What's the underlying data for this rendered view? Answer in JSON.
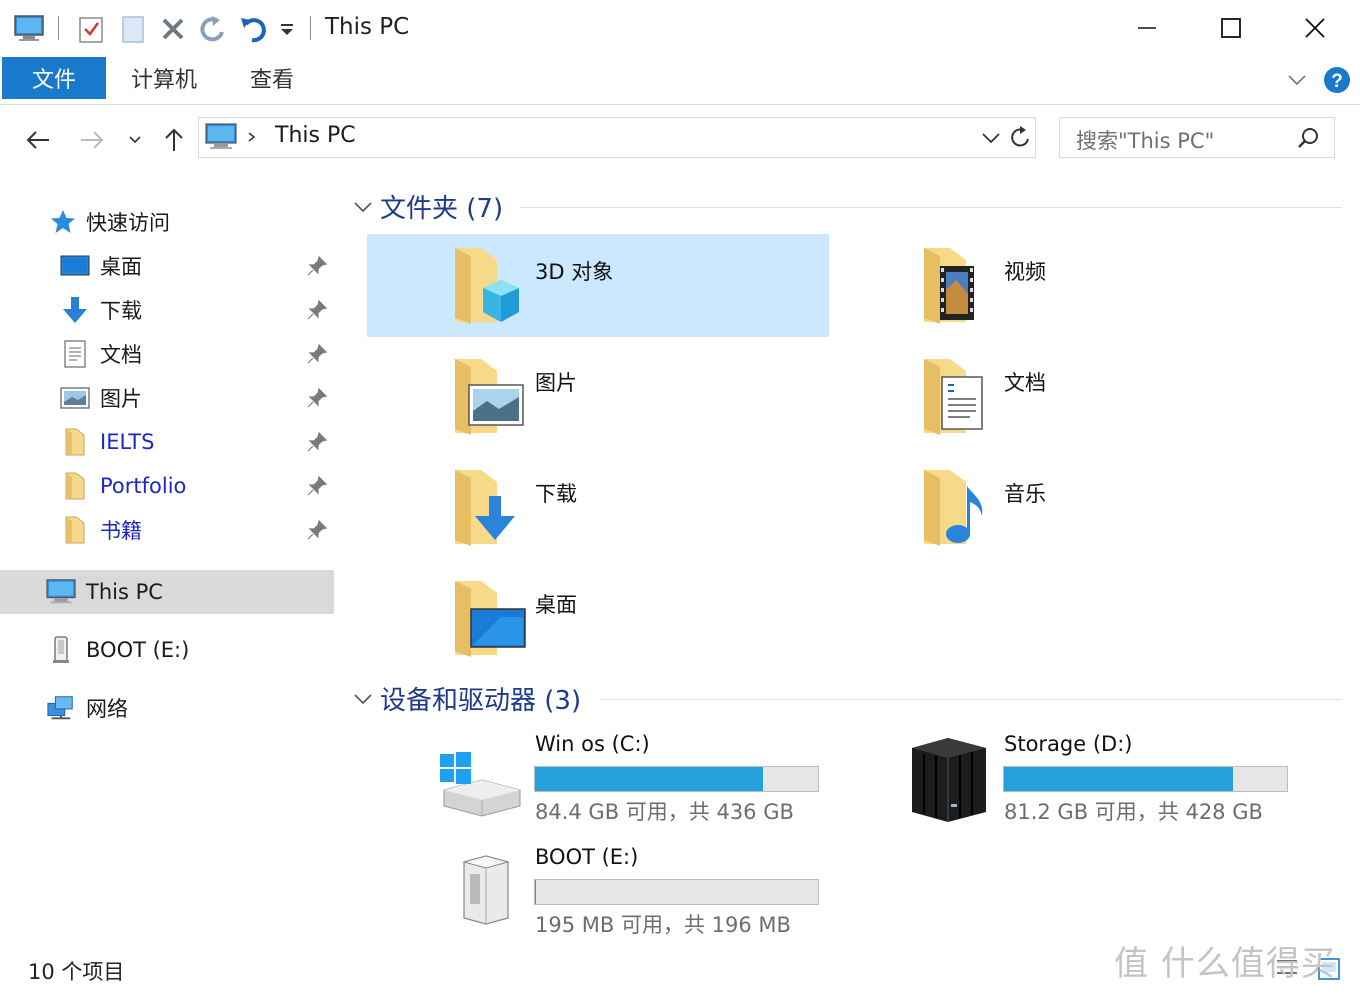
{
  "window": {
    "title": "This PC",
    "quick_access_toolbar": [
      "computer-icon",
      "properties-icon",
      "new-folder-icon",
      "delete-icon",
      "redo-icon",
      "undo-icon",
      "customize-dropdown-icon"
    ]
  },
  "ribbon": {
    "tabs": [
      {
        "label": "文件",
        "active": true
      },
      {
        "label": "计算机",
        "active": false
      },
      {
        "label": "查看",
        "active": false
      }
    ]
  },
  "address": {
    "path": "This PC",
    "search_placeholder": "搜索\"This PC\""
  },
  "nav": {
    "quick_access_label": "快速访问",
    "items": [
      {
        "label": "桌面",
        "icon": "desktop-icon",
        "pinned": true,
        "link": false
      },
      {
        "label": "下载",
        "icon": "download-icon",
        "pinned": true,
        "link": false
      },
      {
        "label": "文档",
        "icon": "document-icon",
        "pinned": true,
        "link": false
      },
      {
        "label": "图片",
        "icon": "picture-icon",
        "pinned": true,
        "link": false
      },
      {
        "label": "IELTS",
        "icon": "folder-icon",
        "pinned": true,
        "link": true
      },
      {
        "label": "Portfolio",
        "icon": "folder-icon",
        "pinned": true,
        "link": true
      },
      {
        "label": "书籍",
        "icon": "folder-icon",
        "pinned": true,
        "link": true
      }
    ],
    "this_pc_label": "This PC",
    "boot_label": "BOOT (E:)",
    "network_label": "网络"
  },
  "folders": {
    "heading": "文件夹 (7)",
    "items": [
      {
        "label": "3D 对象",
        "icon": "3d-objects-folder-icon",
        "selected": true
      },
      {
        "label": "视频",
        "icon": "videos-folder-icon",
        "selected": false
      },
      {
        "label": "图片",
        "icon": "pictures-folder-icon",
        "selected": false
      },
      {
        "label": "文档",
        "icon": "documents-folder-icon",
        "selected": false
      },
      {
        "label": "下载",
        "icon": "downloads-folder-icon",
        "selected": false
      },
      {
        "label": "音乐",
        "icon": "music-folder-icon",
        "selected": false
      },
      {
        "label": "桌面",
        "icon": "desktop-folder-icon",
        "selected": false
      }
    ]
  },
  "drives": {
    "heading": "设备和驱动器 (3)",
    "items": [
      {
        "name": "Win os  (C:)",
        "free_text": "84.4 GB 可用，共 436 GB",
        "used_fraction": 0.806,
        "icon": "windows-drive-icon"
      },
      {
        "name": "Storage (D:)",
        "free_text": "81.2 GB 可用，共 428 GB",
        "used_fraction": 0.81,
        "icon": "nas-drive-icon"
      },
      {
        "name": "BOOT (E:)",
        "free_text": "195 MB 可用，共 196 MB",
        "used_fraction": 0.005,
        "icon": "usb-drive-icon"
      }
    ]
  },
  "status": {
    "item_count": "10 个项目"
  },
  "watermark": "值 什么值得买",
  "colors": {
    "accent": "#1979ca",
    "selection": "#cce8ff",
    "bar_fill": "#26a0da",
    "nav_selected": "#d9d9d9",
    "heading": "#1e3a8a",
    "link": "#1d28c0"
  }
}
